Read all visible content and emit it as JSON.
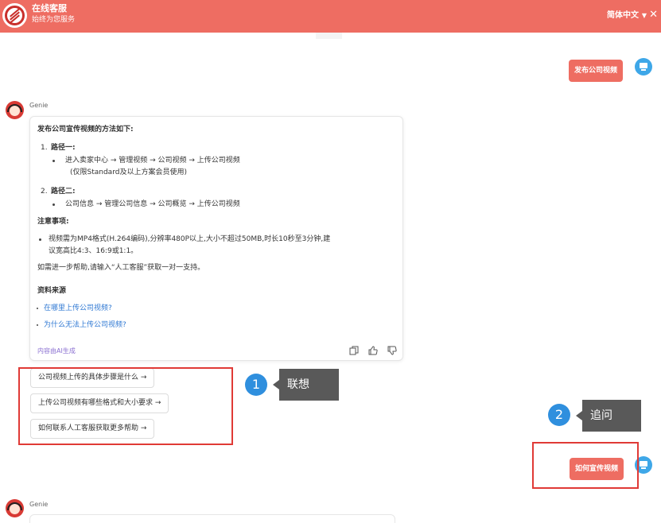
{
  "header": {
    "title": "在线客服",
    "subtitle": "始终为您服务",
    "language": "简体中文",
    "caret": "▼",
    "close": "✕"
  },
  "user_messages": [
    {
      "text": "发布公司视频"
    },
    {
      "text": "如何宣传视频"
    }
  ],
  "bot_name": "Genie",
  "answer": {
    "heading": "发布公司宣传视频的方法如下:",
    "path1_num": "1.",
    "path1_title": "路径一:",
    "path1_step": "进入卖家中心 → 管理视频 → 公司视频 → 上传公司视频",
    "path1_note": "(仅限Standard及以上方案会员使用)",
    "path2_num": "2.",
    "path2_title": "路径二:",
    "path2_step": "公司信息 → 管理公司信息 → 公司概览 → 上传公司视频",
    "notes_title": "注意事项:",
    "note_line1": "视频需为MP4格式(H.264编码),分辨率480P以上,大小不超过50MB,时长10秒至3分钟,建",
    "note_line2": "议宽高比4:3、16:9或1:1。",
    "help_text": "如需进一步帮助,请输入“人工客服”获取一对一支持。",
    "sources_title": "资料来源",
    "sources": [
      "在哪里上传公司视频?",
      "为什么无法上传公司视频?"
    ],
    "ai_label": "内容由AI生成",
    "icons": {
      "copy": "copy-icon",
      "like": "thumbs-up-icon",
      "dislike": "thumbs-down-icon"
    }
  },
  "suggestions": [
    "公司视频上传的具体步骤是什么 →",
    "上传公司视频有哪些格式和大小要求 →",
    "如何联系人工客服获取更多帮助 →"
  ],
  "annotations": [
    {
      "number": "1",
      "label": "联想"
    },
    {
      "number": "2",
      "label": "追问"
    }
  ],
  "colors": {
    "brand": "#ee6d62",
    "user_icon": "#3ea7e8",
    "link": "#2f78d3",
    "highlight": "#e03a36",
    "annotation_number": "#2f8fde",
    "annotation_tag": "#595959"
  }
}
